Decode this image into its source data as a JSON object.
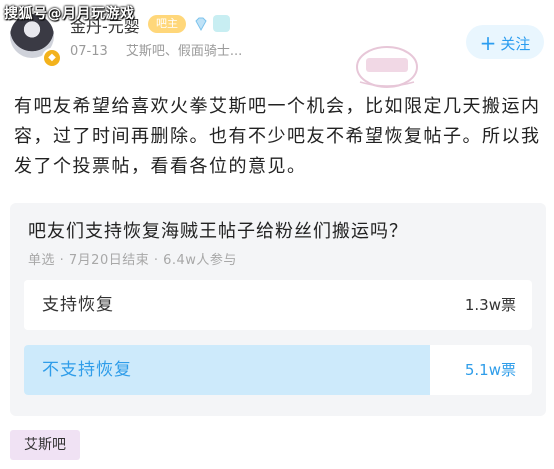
{
  "watermark": "搜狐号@月月玩游戏",
  "post": {
    "author": {
      "name": "金丹-元婴",
      "level_tag": "吧主",
      "gem_icon": "diamond-icon",
      "badge_icon": "member-badge-icon"
    },
    "date": "07-13",
    "forums": "艾斯吧、假面骑士...",
    "follow_label": "关注",
    "body": "有吧友希望给喜欢火拳艾斯吧一个机会，比如限定几天搬运内容，过了时间再删除。也有不少吧友不希望恢复帖子。所以我发了个投票帖，看看各位的意见。"
  },
  "poll": {
    "question": "吧友们支持恢复海贼王帖子给粉丝们搬运吗？",
    "meta": "单选 · 7月20日结束 · 6.4w人参与",
    "options": [
      {
        "label": "支持恢复",
        "count": "1.3w票",
        "share": 0.2
      },
      {
        "label": "不支持恢复",
        "count": "5.1w票",
        "share": 0.8
      }
    ]
  },
  "topic_tag": "艾斯吧",
  "colors": {
    "accent": "#2b9df0",
    "selected_fill": "#cdeafb",
    "tag_bg": "#f0e2f4"
  }
}
